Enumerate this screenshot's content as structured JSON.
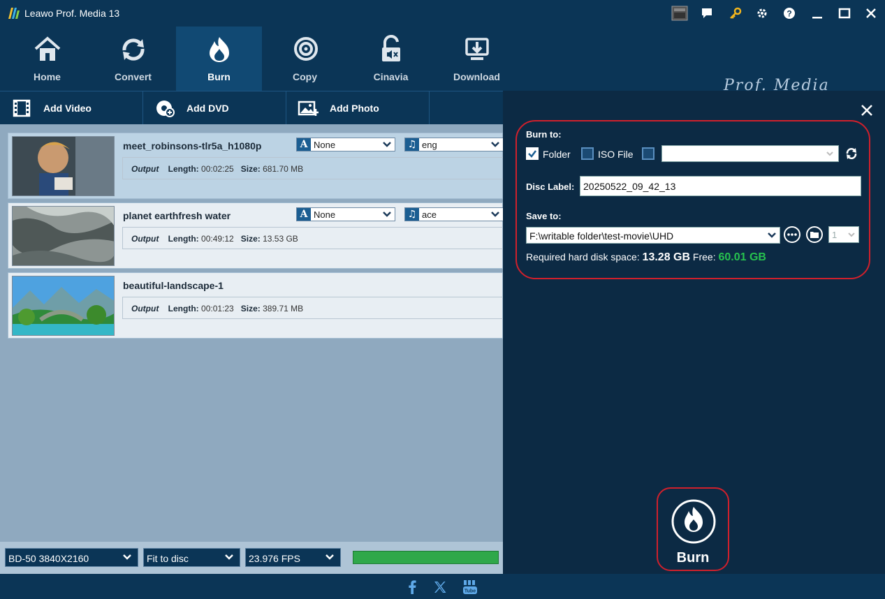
{
  "window": {
    "title": "Leawo Prof. Media 13"
  },
  "nav": {
    "items": [
      {
        "label": "Home"
      },
      {
        "label": "Convert"
      },
      {
        "label": "Burn"
      },
      {
        "label": "Copy"
      },
      {
        "label": "Cinavia"
      },
      {
        "label": "Download"
      }
    ],
    "active": "Burn",
    "brand": "Prof. Media"
  },
  "toolbar": {
    "add_video": "Add Video",
    "add_dvd": "Add DVD",
    "add_photo": "Add Photo"
  },
  "videos": [
    {
      "title": "meet_robinsons-tlr5a_h1080p",
      "output_label": "Output",
      "length_label": "Length:",
      "length": "00:02:25",
      "size_label": "Size:",
      "size": "681.70 MB",
      "subtitle": "None",
      "audio": "eng"
    },
    {
      "title": "planet earthfresh water",
      "output_label": "Output",
      "length_label": "Length:",
      "length": "00:49:12",
      "size_label": "Size:",
      "size": "13.53 GB",
      "subtitle": "None",
      "audio": "ace"
    },
    {
      "title": "beautiful-landscape-1",
      "output_label": "Output",
      "length_label": "Length:",
      "length": "00:01:23",
      "size_label": "Size:",
      "size": "389.71 MB"
    }
  ],
  "bottom": {
    "disc_type": "BD-50 3840X2160",
    "fit": "Fit to disc",
    "fps": "23.976 FPS",
    "progress": 1.0
  },
  "burn_panel": {
    "burn_to_label": "Burn to:",
    "folder_label": "Folder",
    "folder_checked": true,
    "iso_label": "ISO File",
    "iso_checked": false,
    "third_checked": false,
    "drive_value": "",
    "disc_label_label": "Disc Label:",
    "disc_label_value": "20250522_09_42_13",
    "save_to_label": "Save to:",
    "save_to_value": "F:\\writable folder\\test-movie\\UHD",
    "copies": "1",
    "required_label": "Required hard disk space:",
    "required_value": "13.28 GB",
    "free_label": "Free:",
    "free_value": "60.01 GB",
    "burn_button": "Burn"
  },
  "colors": {
    "accent_red": "#d0202c",
    "free_green": "#27c24f",
    "panel_dark": "#0c2a44",
    "header": "#0b3556"
  }
}
